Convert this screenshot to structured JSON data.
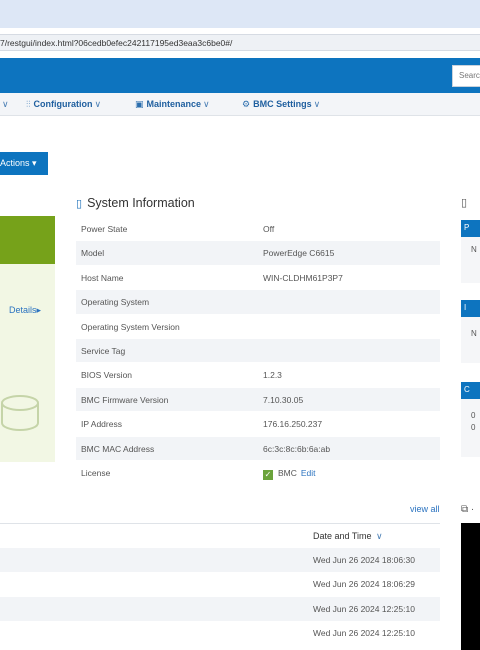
{
  "browser": {
    "url": "7/restgui/index.html?06cedb0efec242117195ed3eaa3c6be0#/"
  },
  "header": {
    "search_placeholder": "Search"
  },
  "menu": {
    "items": [
      {
        "label": "Configuration",
        "icon": "sliders-icon"
      },
      {
        "label": "Maintenance",
        "icon": "maintenance-icon"
      },
      {
        "label": "BMC Settings",
        "icon": "gears-icon"
      }
    ]
  },
  "actions": {
    "label": "Actions"
  },
  "summary": {
    "details_label": "Details"
  },
  "system_info": {
    "title": "System Information",
    "rows": [
      {
        "key": "Power State",
        "value": "Off"
      },
      {
        "key": "Model",
        "value": "PowerEdge C6615"
      },
      {
        "key": "Host Name",
        "value": "WIN-CLDHM61P3P7"
      },
      {
        "key": "Operating System",
        "value": ""
      },
      {
        "key": "Operating System Version",
        "value": ""
      },
      {
        "key": "Service Tag",
        "value": ""
      },
      {
        "key": "BIOS Version",
        "value": "1.2.3"
      },
      {
        "key": "BMC Firmware Version",
        "value": "7.10.30.05"
      },
      {
        "key": "IP Address",
        "value": "176.16.250.237"
      },
      {
        "key": "BMC MAC Address",
        "value": "6c:3c:8c:6b:6a:ab"
      }
    ],
    "license": {
      "key": "License",
      "value": "BMC",
      "edit_label": "Edit"
    }
  },
  "right_panel": {
    "heads": [
      "P",
      "I",
      "C"
    ],
    "texts": [
      "N",
      "N",
      "0",
      "0"
    ]
  },
  "logs": {
    "view_all_label": "view all",
    "date_header": "Date and Time",
    "rows": [
      "Wed Jun 26 2024 18:06:30",
      "Wed Jun 26 2024 18:06:29",
      "Wed Jun 26 2024 12:25:10",
      "Wed Jun 26 2024 12:25:10"
    ]
  },
  "colors": {
    "brand_blue": "#0d74bf",
    "health_green": "#76a21a",
    "row_shade": "#f2f4f7"
  }
}
